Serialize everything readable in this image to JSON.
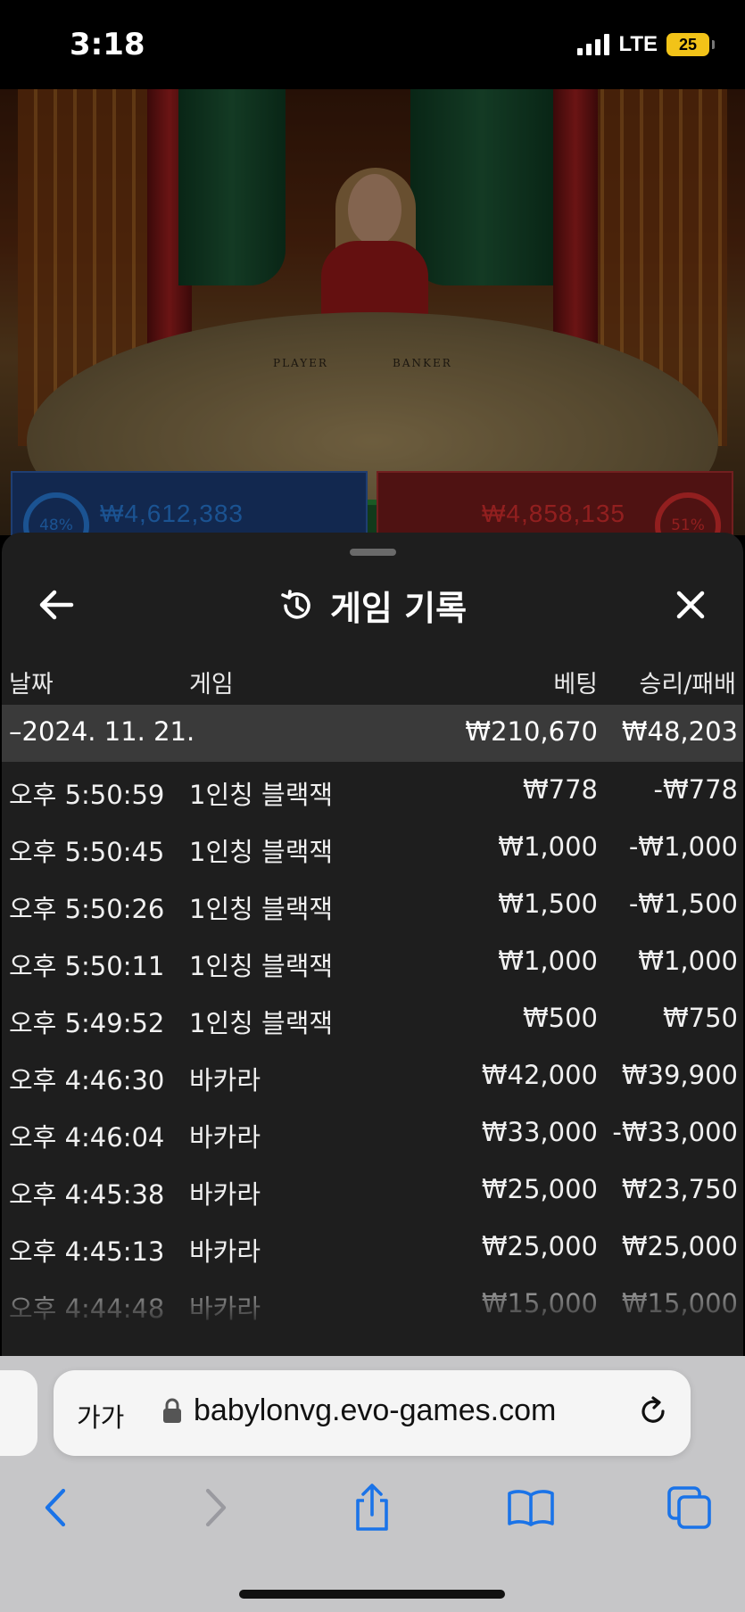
{
  "status_bar": {
    "time": "3:18",
    "network": "LTE",
    "battery": "25"
  },
  "game_view": {
    "table_labels": [
      "PLAYER",
      "BANKER"
    ],
    "player_pct": "48%",
    "player_amount": "₩4,612,383",
    "banker_pct": "51%",
    "banker_amount": "₩4,858,135"
  },
  "sheet": {
    "title": "게임 기록",
    "icons": {
      "back": "arrow-left-icon",
      "close": "close-icon",
      "title": "history-icon"
    },
    "columns": {
      "date": "날짜",
      "game": "게임",
      "bet": "베팅",
      "result": "승리/패배"
    },
    "date_group": {
      "date": "–2024. 11. 21.",
      "bet_total": "₩210,670",
      "result_total": "₩48,203"
    },
    "rows": [
      {
        "time": "오후 5:50:59",
        "game": "1인칭 블랙잭",
        "bet": "₩778",
        "result": "-₩778"
      },
      {
        "time": "오후 5:50:45",
        "game": "1인칭 블랙잭",
        "bet": "₩1,000",
        "result": "-₩1,000"
      },
      {
        "time": "오후 5:50:26",
        "game": "1인칭 블랙잭",
        "bet": "₩1,500",
        "result": "-₩1,500"
      },
      {
        "time": "오후 5:50:11",
        "game": "1인칭 블랙잭",
        "bet": "₩1,000",
        "result": "₩1,000"
      },
      {
        "time": "오후 5:49:52",
        "game": "1인칭 블랙잭",
        "bet": "₩500",
        "result": "₩750"
      },
      {
        "time": "오후 4:46:30",
        "game": "바카라",
        "bet": "₩42,000",
        "result": "₩39,900"
      },
      {
        "time": "오후 4:46:04",
        "game": "바카라",
        "bet": "₩33,000",
        "result": "-₩33,000"
      },
      {
        "time": "오후 4:45:38",
        "game": "바카라",
        "bet": "₩25,000",
        "result": "₩23,750"
      },
      {
        "time": "오후 4:45:13",
        "game": "바카라",
        "bet": "₩25,000",
        "result": "₩25,000"
      },
      {
        "time": "오후 4:44:48",
        "game": "바카라",
        "bet": "₩15,000",
        "result": "₩15,000"
      }
    ]
  },
  "browser": {
    "aa_label": "가가",
    "url": "babylonvg.evo-games.com",
    "icons": {
      "lock": "lock-icon",
      "reload": "reload-icon",
      "back": "chevron-left-icon",
      "forward": "chevron-right-icon",
      "share": "share-icon",
      "bookmarks": "book-icon",
      "tabs": "tabs-icon"
    },
    "accent_color": "#1a73e8"
  }
}
